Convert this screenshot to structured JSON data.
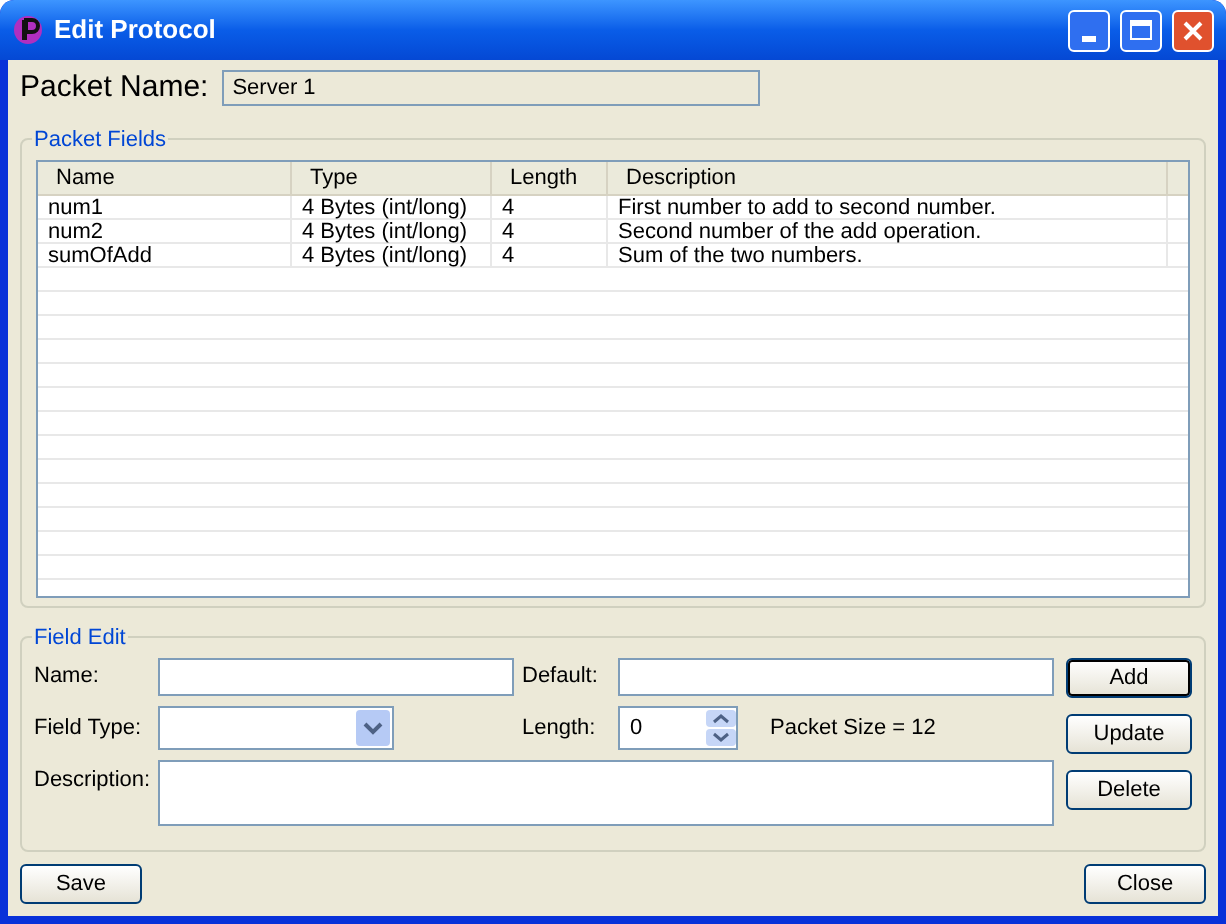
{
  "window": {
    "title": "Edit Protocol"
  },
  "packet_name": {
    "label": "Packet Name:",
    "value": "Server 1"
  },
  "packet_fields": {
    "title": "Packet Fields",
    "columns": [
      "Name",
      "Type",
      "Length",
      "Description"
    ],
    "rows": [
      {
        "cells": [
          "num1",
          "4 Bytes (int/long)",
          "4",
          "First number to add to second number."
        ]
      },
      {
        "cells": [
          "num2",
          "4 Bytes (int/long)",
          "4",
          "Second number of the add operation."
        ]
      },
      {
        "cells": [
          "sumOfAdd",
          "4 Bytes (int/long)",
          "4",
          "Sum of the two numbers."
        ]
      }
    ]
  },
  "field_edit": {
    "title": "Field Edit",
    "name_label": "Name:",
    "default_label": "Default:",
    "field_type_label": "Field Type:",
    "length_label": "Length:",
    "length_value": "0",
    "packet_size": "Packet Size = 12",
    "description_label": "Description:",
    "buttons": [
      {
        "label": "Add",
        "focused": true
      },
      {
        "label": "Update",
        "focused": false
      },
      {
        "label": "Delete",
        "focused": false
      }
    ]
  },
  "footer_buttons": [
    "Save",
    "Close"
  ]
}
